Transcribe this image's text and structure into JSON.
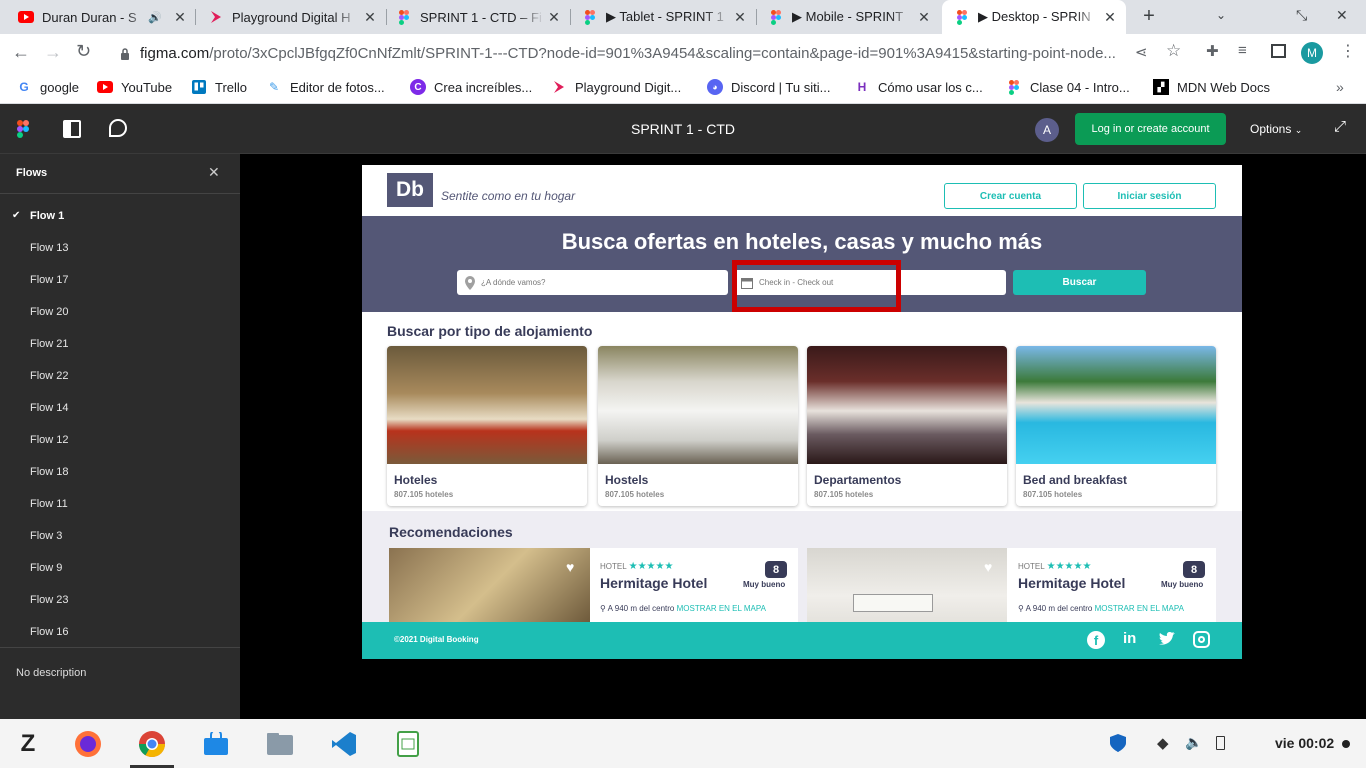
{
  "browser": {
    "tabs": [
      {
        "title": "Duran Duran - S",
        "icon": "youtube-icon",
        "audio": true
      },
      {
        "title": "Playground Digital H",
        "icon": "playground-icon"
      },
      {
        "title": "SPRINT 1 - CTD – Fi",
        "icon": "figma-icon"
      },
      {
        "title": "▶ Tablet - SPRINT 1",
        "icon": "figma-icon"
      },
      {
        "title": "▶ Mobile - SPRINT",
        "icon": "figma-icon"
      },
      {
        "title": "▶ Desktop - SPRIN",
        "icon": "figma-icon",
        "active": true
      }
    ],
    "url_domain": "figma.com",
    "url_path": "/proto/3xCpclJBfgqZf0CnNfZmlt/SPRINT-1---CTD?node-id=901%3A9454&scaling=contain&page-id=901%3A9415&starting-point-node...",
    "profile_initial": "M",
    "bookmarks": [
      {
        "label": "google",
        "icon": "google-icon"
      },
      {
        "label": "YouTube",
        "icon": "youtube-icon"
      },
      {
        "label": "Trello",
        "icon": "trello-icon"
      },
      {
        "label": "Editor de fotos...",
        "icon": "photo-editor-icon"
      },
      {
        "label": "Crea increíbles...",
        "icon": "canva-icon"
      },
      {
        "label": "Playground Digit...",
        "icon": "playground-icon"
      },
      {
        "label": "Discord | Tu siti...",
        "icon": "discord-icon"
      },
      {
        "label": "Cómo usar los c...",
        "icon": "hackernoon-icon"
      },
      {
        "label": "Clase 04 - Intro...",
        "icon": "figma-icon"
      },
      {
        "label": "MDN Web Docs",
        "icon": "mdn-icon"
      }
    ]
  },
  "figma": {
    "title": "SPRINT 1 - CTD",
    "avatar_initial": "A",
    "login_label": "Log in or create account",
    "options_label": "Options",
    "flows_title": "Flows",
    "flows": [
      "Flow 1",
      "Flow 13",
      "Flow 17",
      "Flow 20",
      "Flow 21",
      "Flow 22",
      "Flow 14",
      "Flow 12",
      "Flow 18",
      "Flow 11",
      "Flow 3",
      "Flow 9",
      "Flow 23",
      "Flow 16"
    ],
    "selected_flow": "Flow 1",
    "description": "No description"
  },
  "site": {
    "logo": "Db",
    "tagline": "Sentite como en tu hogar",
    "create_account": "Crear cuenta",
    "login": "Iniciar sesión",
    "hero_title": "Busca ofertas en hoteles, casas y mucho más",
    "destination_placeholder": "¿A dónde vamos?",
    "dates_placeholder": "Check in - Check out",
    "search_button": "Buscar",
    "category_heading": "Buscar por tipo de alojamiento",
    "categories": [
      {
        "title": "Hoteles",
        "count": "807.105 hoteles"
      },
      {
        "title": "Hostels",
        "count": "807.105 hoteles"
      },
      {
        "title": "Departamentos",
        "count": "807.105 hoteles"
      },
      {
        "title": "Bed and breakfast",
        "count": "807.105 hoteles"
      }
    ],
    "recs_heading": "Recomendaciones",
    "recommendations": [
      {
        "category": "HOTEL",
        "stars": "★★★★★",
        "name": "Hermitage Hotel",
        "score": "8",
        "rating": "Muy bueno",
        "distance": "A 940 m del centro",
        "map_link": "MOSTRAR EN EL MAPA"
      },
      {
        "category": "HOTEL",
        "stars": "★★★★★",
        "name": "Hermitage Hotel",
        "score": "8",
        "rating": "Muy bueno",
        "distance": "A 940 m del centro",
        "map_link": "MOSTRAR EN EL MAPA"
      }
    ],
    "footer": "©2021 Digital Booking",
    "colors": {
      "primary": "#383b58",
      "accent": "#1dbeb4",
      "hero_bg": "#545776",
      "highlight": "#cc0000"
    }
  },
  "taskbar": {
    "clock": "vie 00:02"
  }
}
